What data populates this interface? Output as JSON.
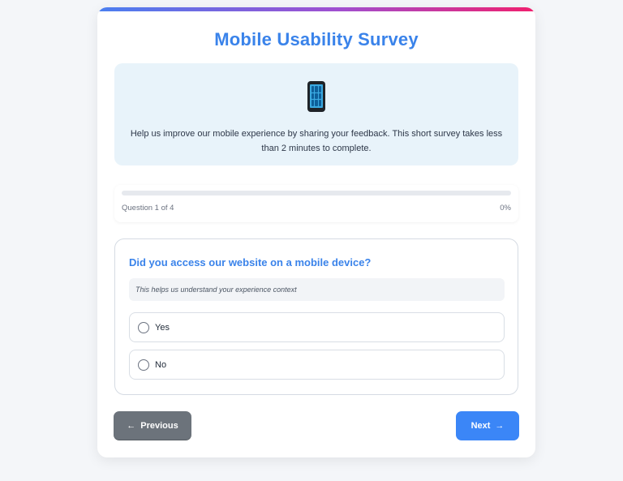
{
  "survey": {
    "title": "Mobile Usability Survey",
    "intro_icon": "mobile-phone-icon",
    "intro_text": "Help us improve our mobile experience by sharing your feedback. This short survey takes less than 2 minutes to complete."
  },
  "progress": {
    "counter_text": "Question 1 of 4",
    "percent_text": "0%",
    "value": 0
  },
  "question": {
    "title": "Did you access our website on a mobile device?",
    "hint": "This helps us understand your experience context",
    "options": [
      {
        "label": "Yes",
        "selected": false
      },
      {
        "label": "No",
        "selected": false
      }
    ]
  },
  "navigation": {
    "prev_arrow": "←",
    "prev_label": "Previous",
    "next_label": "Next",
    "next_arrow": "→"
  },
  "colors": {
    "accent": "#3a83ea",
    "next_button": "#3b86f7",
    "prev_button": "#6c737b",
    "intro_background": "#e8f3fa"
  }
}
